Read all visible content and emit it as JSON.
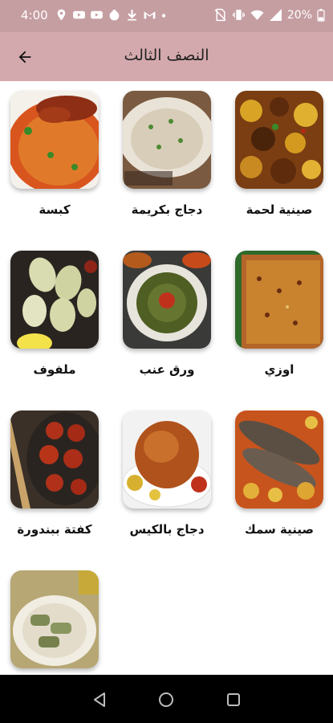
{
  "status_bar": {
    "time": "4:00",
    "battery_percent": "20%",
    "icons_left": [
      "location-icon",
      "youtube-icon",
      "youtube-icon",
      "chef-icon",
      "download-icon",
      "gmail-icon",
      "dot-icon"
    ],
    "icons_right": [
      "no-sim-icon",
      "vibrate-icon",
      "wifi-icon",
      "signal-icon",
      "battery-icon"
    ]
  },
  "app_bar": {
    "title": "النصف الثالث",
    "back_icon": "arrow-left-icon"
  },
  "recipes": [
    {
      "label": "صينية لحمة",
      "image": "meat-tray-photo"
    },
    {
      "label": "دجاج بكريمة",
      "image": "creamy-chicken-photo"
    },
    {
      "label": "كبسة",
      "image": "kabsa-photo"
    },
    {
      "label": "اوزي",
      "image": "ouzi-photo"
    },
    {
      "label": "ورق عنب",
      "image": "grape-leaves-photo"
    },
    {
      "label": "ملفوف",
      "image": "cabbage-rolls-photo"
    },
    {
      "label": "صينية سمك",
      "image": "fish-tray-photo"
    },
    {
      "label": "دجاج بالكيس",
      "image": "bag-chicken-photo"
    },
    {
      "label": "كفتة ببندورة",
      "image": "kofta-tomato-photo"
    },
    {
      "label": "",
      "image": "stuffed-rolls-photo"
    }
  ],
  "nav_bar": {
    "back_icon": "nav-back-icon",
    "home_icon": "nav-home-icon",
    "recents_icon": "nav-recents-icon"
  },
  "colors": {
    "status_bar": "#c59ea2",
    "app_bar": "#d4a9ad",
    "background": "#ffffff",
    "nav_bar": "#000000"
  }
}
